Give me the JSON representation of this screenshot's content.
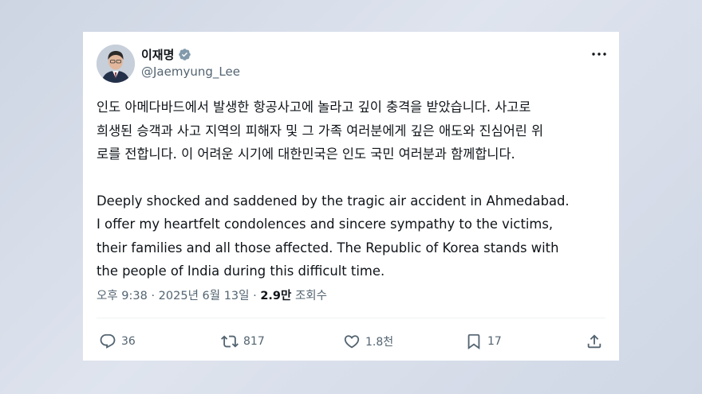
{
  "author": {
    "name": "이재명",
    "handle": "@Jaemyung_Lee"
  },
  "tweet": {
    "lines": [
      "인도 아메다바드에서 발생한 항공사고에 놀라고 깊이 충격을 받았습니다. 사고로",
      "희생된 승객과 사고 지역의 피해자 및 그 가족 여러분에게 깊은 애도와 진심어린 위",
      "로를 전합니다. 이 어려운 시기에 대한민국은 인도 국민 여러분과 함께합니다.",
      "Deeply shocked and saddened by the tragic air accident in Ahmedabad.",
      "I offer my heartfelt condolences and sincere sympathy to the victims,",
      "their families and all those affected. The Republic of Korea stands with",
      "the people of India during this difficult time."
    ]
  },
  "meta": {
    "time_date": "오후 9:38 · 2025년 6월 13일 · ",
    "views": "2.9만",
    "views_label": " 조회수"
  },
  "actions": {
    "replies": "36",
    "reposts": "817",
    "likes": "1.8천",
    "bookmarks": "17"
  },
  "colors": {
    "text": "#0f1419",
    "secondary": "#536471",
    "verified": "#829aab"
  },
  "icons": [
    "verified-badge-icon",
    "more-icon",
    "reply-icon",
    "repost-icon",
    "like-icon",
    "bookmark-icon",
    "share-icon"
  ]
}
